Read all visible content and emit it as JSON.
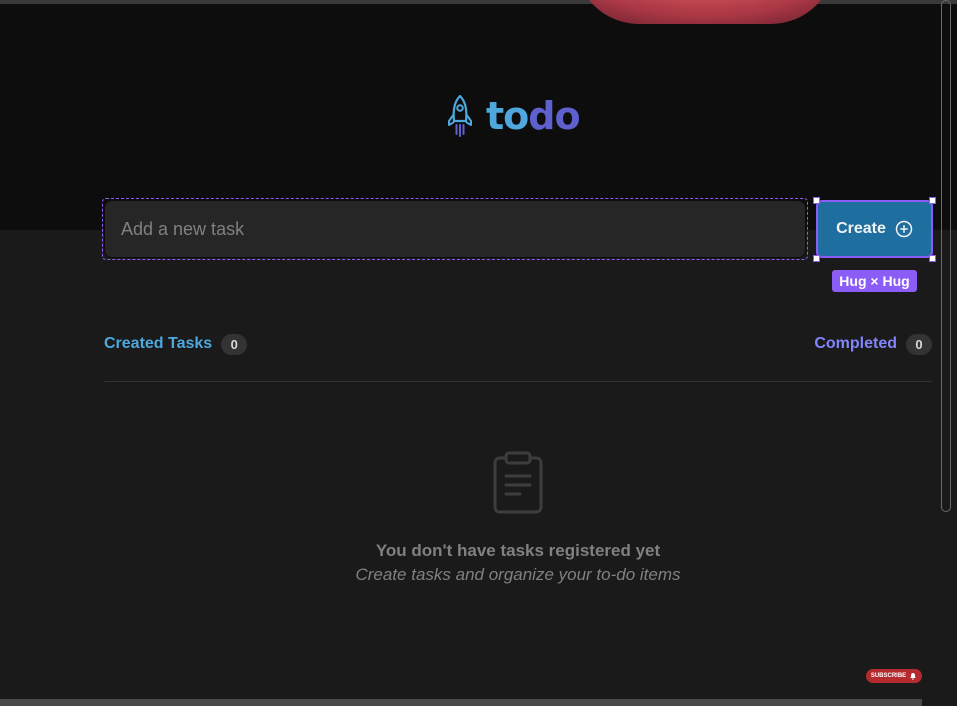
{
  "app": {
    "logo": {
      "part1": "to",
      "part2": "do",
      "icon": "rocket-icon"
    },
    "colors": {
      "brand_blue": "#4ea8de",
      "brand_purple": "#5e60ce",
      "button_blue": "#1e6f9f",
      "selection_purple": "#8b5cf6"
    }
  },
  "new_task": {
    "placeholder": "Add a new task",
    "value": "",
    "create_label": "Create",
    "create_icon": "plus-circle-icon"
  },
  "design_overlay": {
    "size_label": "Hug × Hug"
  },
  "counters": {
    "created": {
      "label": "Created Tasks",
      "count": "0"
    },
    "completed": {
      "label": "Completed",
      "count": "0"
    }
  },
  "empty_state": {
    "icon": "clipboard-icon",
    "title": "You don't have tasks registered yet",
    "subtitle": "Create tasks and organize your to-do items"
  },
  "youtube_overlay": {
    "subscribe_label": "SUBSCRIBE",
    "icon": "bell-icon"
  }
}
